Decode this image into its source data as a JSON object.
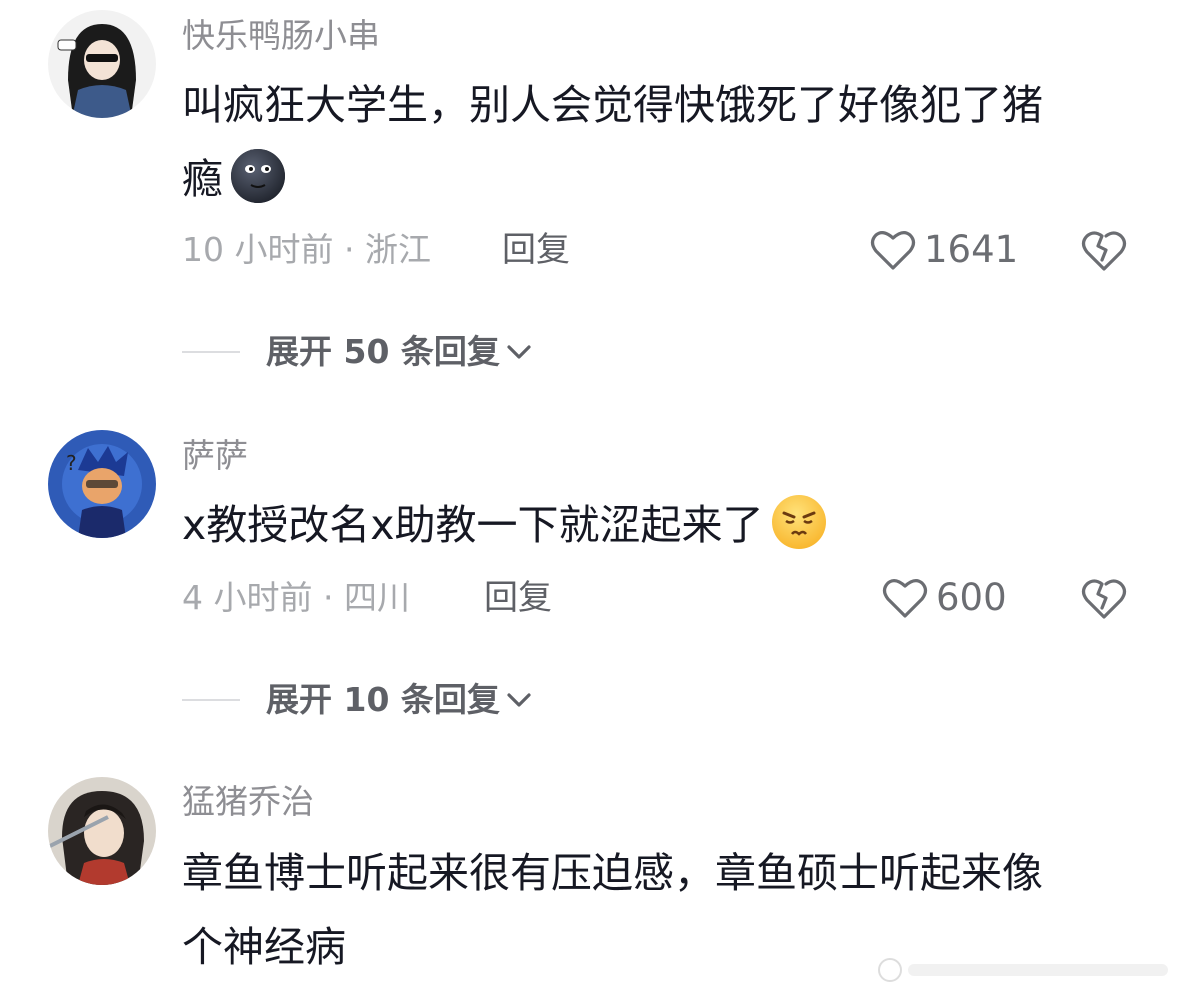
{
  "comments": [
    {
      "author": "快乐鸭肠小串",
      "text_line1": "叫疯狂大学生，别人会觉得快饿死了好像犯了猪",
      "text_line2": "瘾",
      "emoji": "dark-moon-face-emoji",
      "time": "10 小时前",
      "location": "浙江",
      "separator": " · ",
      "reply_label": "回复",
      "likes": "1641",
      "expand_label": "展开 50 条回复"
    },
    {
      "author": "萨萨",
      "text_line1": "x教授改名x助教一下就涩起来了",
      "emoji": "pouting-face-emoji",
      "time": "4 小时前",
      "location": "四川",
      "separator": " · ",
      "reply_label": "回复",
      "likes": "600",
      "expand_label": "展开 10 条回复"
    },
    {
      "author": "猛猪乔治",
      "text_line1": "章鱼博士听起来很有压迫感，章鱼硕士听起来像",
      "text_line2": "个神经病"
    }
  ],
  "icons": {
    "like": "heart-outline-icon",
    "dislike": "broken-heart-icon",
    "expand": "chevron-down-icon"
  },
  "colors": {
    "text": "#161823",
    "muted": "#a7a9ad",
    "author": "#8e8e93"
  }
}
